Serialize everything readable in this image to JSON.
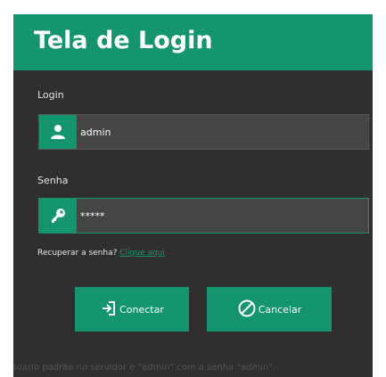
{
  "window": {
    "title": "Tela de Login"
  },
  "login": {
    "label": "Login",
    "value": "admin",
    "icon": "user-icon"
  },
  "password": {
    "label": "Senha",
    "value": "*****",
    "icon": "key-icon"
  },
  "recover": {
    "text": "Recuperar a senha?",
    "link": "Clique aqui"
  },
  "buttons": {
    "connect": "Conectar",
    "cancel": "Cancelar"
  },
  "footer": {
    "note": "O usuário padrão no  servidor é \"admin\" com a senha \"admin\"."
  },
  "colors": {
    "accent": "#14956f",
    "background": "#2f2f2f",
    "field": "#454545"
  }
}
